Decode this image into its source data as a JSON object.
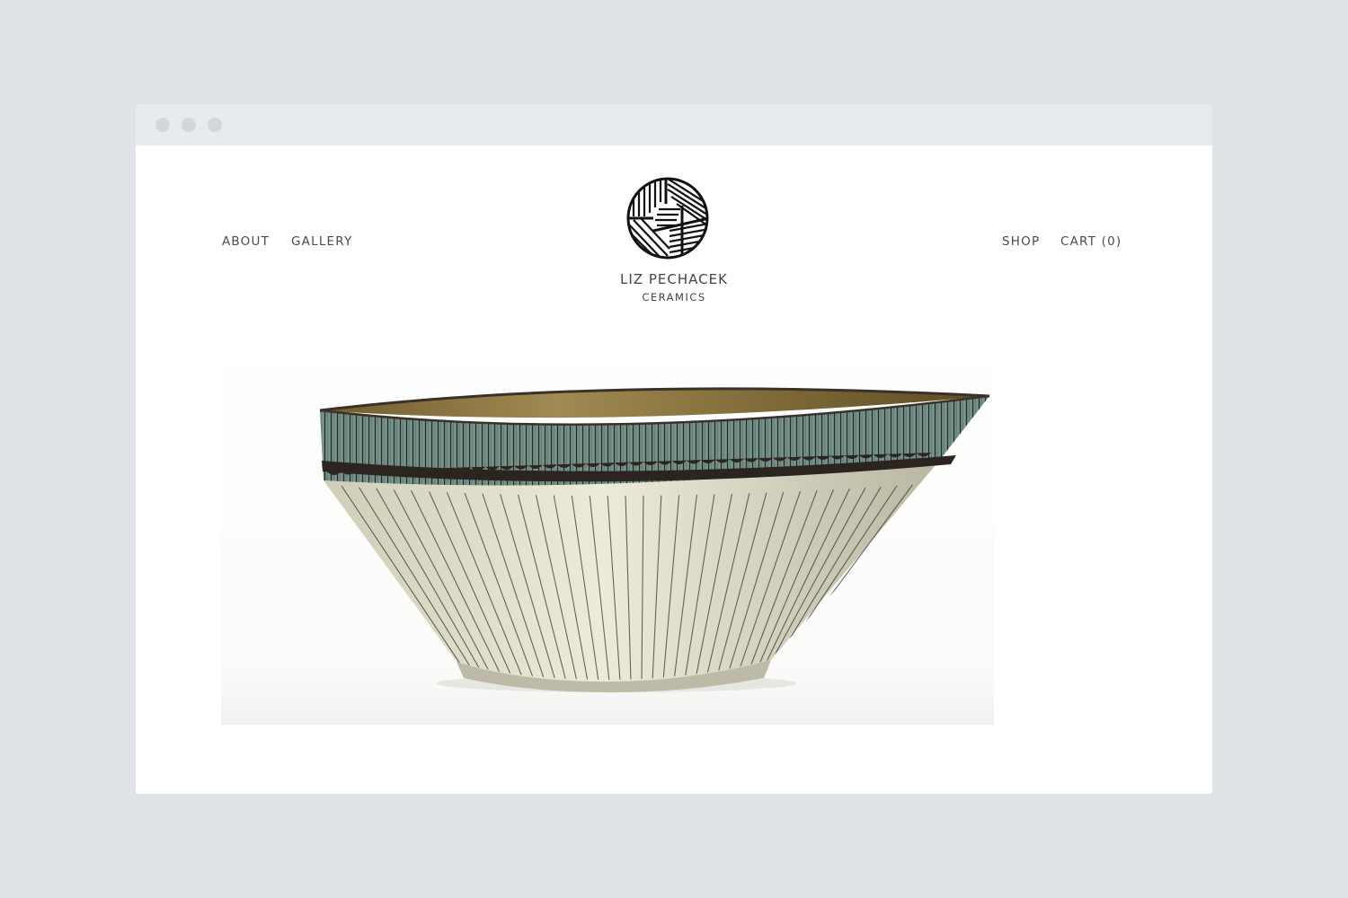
{
  "window": {
    "traffic_lights": [
      "close",
      "minimize",
      "maximize"
    ]
  },
  "nav": {
    "left": [
      {
        "label": "ABOUT"
      },
      {
        "label": "GALLERY"
      }
    ],
    "right": [
      {
        "label": "SHOP"
      },
      {
        "label": "CART (0)"
      }
    ]
  },
  "brand": {
    "name": "LIZ PECHACEK",
    "subtitle": "CERAMICS",
    "logo_icon": "striped-circle-logo-icon"
  },
  "hero": {
    "image_subject": "ceramic-bowl-icon",
    "colors": {
      "rim_interior": "#8a7440",
      "band": "#6f8f86",
      "stripe": "#2a2622",
      "body": "#e4e2cf"
    }
  }
}
